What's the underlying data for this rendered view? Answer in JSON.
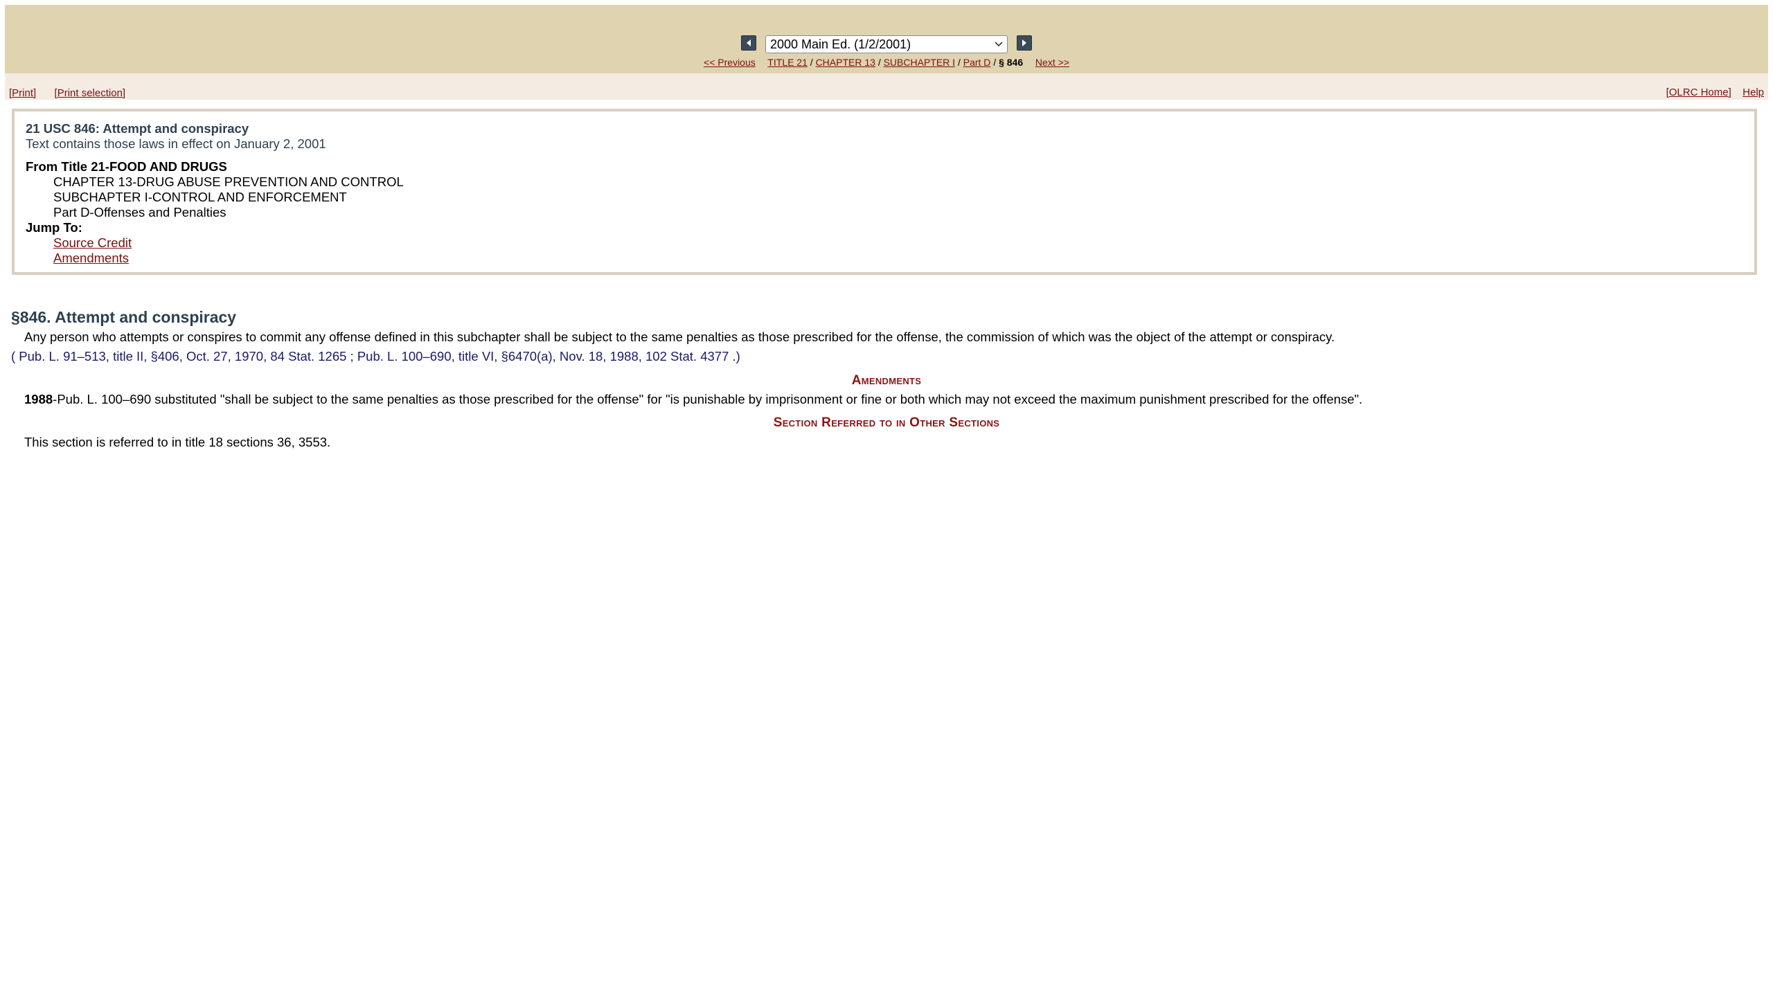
{
  "nav": {
    "edition_selected": "2000 Main Ed. (1/2/2001)",
    "previous": "<< Previous",
    "next": "Next >>",
    "breadcrumb": {
      "title": "TITLE 21",
      "chapter": "CHAPTER 13",
      "subchapter": "SUBCHAPTER I",
      "part": "Part D",
      "current": "§ 846",
      "separator": "/"
    }
  },
  "toolbar": {
    "print": "[Print]",
    "print_selection": "[Print selection]",
    "olrc_home": "[OLRC Home]",
    "help": "Help"
  },
  "info": {
    "title": "21 USC 846: Attempt and conspiracy",
    "subtitle": "Text contains those laws in effect on January 2, 2001",
    "from_title": "From Title 21-FOOD AND DRUGS",
    "chapter": "CHAPTER 13-DRUG ABUSE PREVENTION AND CONTROL",
    "subchapter": "SUBCHAPTER I-CONTROL AND ENFORCEMENT",
    "part": "Part D-Offenses and Penalties",
    "jump_to": "Jump To:",
    "jump_links": [
      "Source Credit",
      "Amendments"
    ]
  },
  "section": {
    "heading": "§846. Attempt and conspiracy",
    "text": "Any person who attempts or conspires to commit any offense defined in this subchapter shall be subject to the same penalties as those prescribed for the offense, the commission of which was the object of the attempt or conspiracy.",
    "source_credit": "( Pub. L. 91–513, title II, §406, Oct. 27, 1970, 84 Stat. 1265 ; Pub. L. 100–690, title VI, §6470(a), Nov. 18, 1988, 102 Stat. 4377 .)"
  },
  "amendments": {
    "heading": "Amendments",
    "year": "1988",
    "text": "-Pub. L. 100–690 substituted \"shall be subject to the same penalties as those prescribed for the offense\" for \"is punishable by imprisonment or fine or both which may not exceed the maximum punishment prescribed for the offense\"."
  },
  "references": {
    "heading": "Section Referred to in Other Sections",
    "text": "This section is referred to in title 18 sections 36, 3553."
  },
  "colors": {
    "nav_band": "#e0d3b0",
    "print_bar": "#f4ebe3",
    "link": "#7a1010",
    "heading": "#2d4150",
    "note_heading": "#8b1414"
  }
}
